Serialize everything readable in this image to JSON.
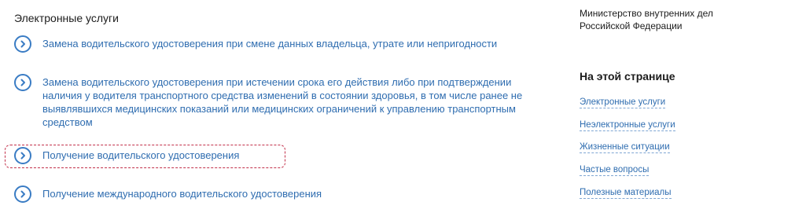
{
  "main": {
    "section_title": "Электронные услуги",
    "services": [
      {
        "label": "Замена водительского удостоверения при смене данных владельца, утрате или непригодности",
        "icon": "chevron-right-circle-icon"
      },
      {
        "label": "Замена водительского удостоверения при истечении срока его действия либо при подтверждении наличия у водителя транспортного средства изменений в состоянии здоровья, в том числе ранее не выявлявшихся медицинских показаний или медицинских ограничений к управлению транспортным средством",
        "icon": "chevron-right-circle-icon"
      },
      {
        "label": "Получение водительского удостоверения",
        "icon": "chevron-right-circle-icon",
        "focused": true
      },
      {
        "label": "Получение международного водительского удостоверения",
        "icon": "chevron-right-circle-icon"
      }
    ]
  },
  "aside": {
    "ministry": "Министерство внутренних дел Российской Федерации",
    "onpage_title": "На этой странице",
    "anchors": [
      {
        "label": "Электронные услуги"
      },
      {
        "label": "Неэлектронные услуги"
      },
      {
        "label": "Жизненные ситуации"
      },
      {
        "label": "Частые вопросы"
      },
      {
        "label": "Полезные материалы"
      }
    ]
  },
  "colors": {
    "link": "#2f6db0",
    "icon": "#3a7cc4",
    "text": "#1c1c1c",
    "focus_ring": "#c2304a"
  }
}
